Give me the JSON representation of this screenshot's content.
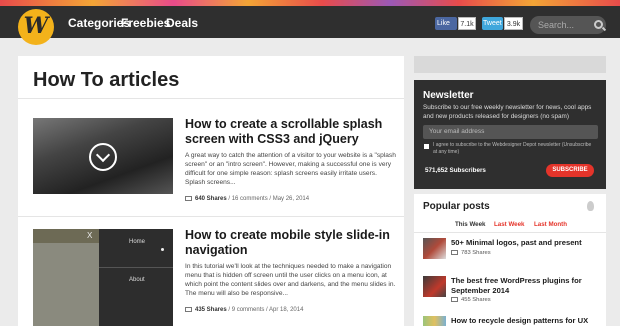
{
  "logo": {
    "letter": "W"
  },
  "nav": {
    "items": [
      "Categories",
      "Freebies",
      "Deals"
    ]
  },
  "social": {
    "like": "Like",
    "like_count": "7.1k",
    "tweet": "Tweet",
    "tweet_count": "3.9k"
  },
  "search": {
    "placeholder": "Search..."
  },
  "main": {
    "title": "How To articles",
    "articles": [
      {
        "title": "How to create a scrollable splash screen with CSS3 and jQuery",
        "excerpt": "A great way to catch the attention of a visitor to your website is a \"splash screen\" or an \"intro screen\". However, making a successful one is very difficult for one simple reason: splash screens easily irritate users. Splash screens...",
        "shares": "640 Shares",
        "meta": " / 16 comments / May 26, 2014"
      },
      {
        "title": "How to create mobile style slide-in navigation",
        "excerpt": "In this tutorial we'll look at the techniques needed to make a navigation menu that is hidden off screen until the user clicks on a menu icon, at which point the content slides over and darkens, and the menu slides in. The menu will also be responsive...",
        "shares": "435 Shares",
        "meta": " / 9 comments / Apr 18, 2014",
        "thumb": {
          "close": "X",
          "home": "Home",
          "about": "About"
        }
      }
    ]
  },
  "newsletter": {
    "title": "Newsletter",
    "description": "Subscribe to our free weekly newsletter for news, cool apps and new products released for designers (no spam)",
    "email_placeholder": "Your email address",
    "agree": "I agree to subscribe to the Webdesigner Depot newsletter (Unsubscribe at any time)",
    "subscribers": "571,652 Subscribers",
    "subscribe": "SUBSCRIBE"
  },
  "popular": {
    "title": "Popular posts",
    "tabs": [
      "This Week",
      "Last Week",
      "Last Month"
    ],
    "items": [
      {
        "title": "50+ Minimal logos, past and present",
        "shares": "783 Shares"
      },
      {
        "title": "The best free WordPress plugins for September 2014",
        "shares": "455 Shares"
      },
      {
        "title": "How to recycle design patterns for UX"
      }
    ]
  },
  "colors": {
    "accent": "#e5342a",
    "logo": "#f3b21b",
    "topbar": "#2f2f2f"
  }
}
